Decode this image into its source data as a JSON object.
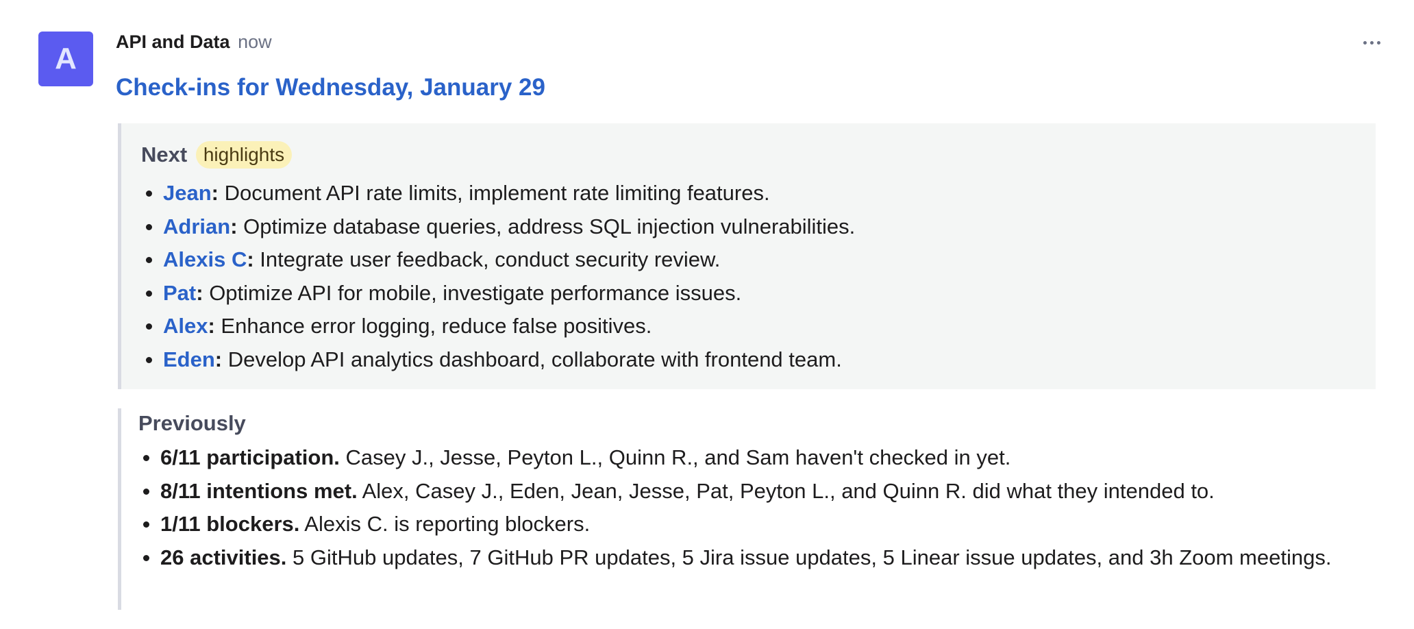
{
  "message": {
    "avatar_letter": "A",
    "sender": "API and Data",
    "time": "now",
    "title": "Check-ins for Wednesday, January 29"
  },
  "next": {
    "heading": "Next",
    "badge": "highlights",
    "items": [
      {
        "name": "Jean",
        "text": " Document API rate limits, implement rate limiting features."
      },
      {
        "name": "Adrian",
        "text": " Optimize database queries, address SQL injection vulnerabilities."
      },
      {
        "name": "Alexis C",
        "text": " Integrate user feedback, conduct security review."
      },
      {
        "name": "Pat",
        "text": " Optimize API for mobile, investigate performance issues."
      },
      {
        "name": "Alex",
        "text": " Enhance error logging, reduce false positives."
      },
      {
        "name": "Eden",
        "text": " Develop API analytics dashboard, collaborate with frontend team."
      }
    ]
  },
  "previously": {
    "heading": "Previously",
    "items": [
      {
        "stat": "6/11 participation.",
        "text": " Casey J., Jesse, Peyton L., Quinn R., and Sam haven't checked in yet."
      },
      {
        "stat": "8/11 intentions met.",
        "text": " Alex, Casey J., Eden, Jean, Jesse, Pat, Peyton L., and Quinn R. did what they intended to."
      },
      {
        "stat": "1/11 blockers.",
        "text": " Alexis C. is reporting blockers."
      },
      {
        "stat": "26 activities.",
        "text": " 5 GitHub updates, 7 GitHub PR updates, 5 Jira issue updates, 5 Linear issue updates, and 3h Zoom meetings."
      }
    ]
  },
  "colors": {
    "accent_link": "#2a62c9",
    "avatar_bg": "#5b5bf0",
    "badge_bg": "#fbf1b8"
  }
}
